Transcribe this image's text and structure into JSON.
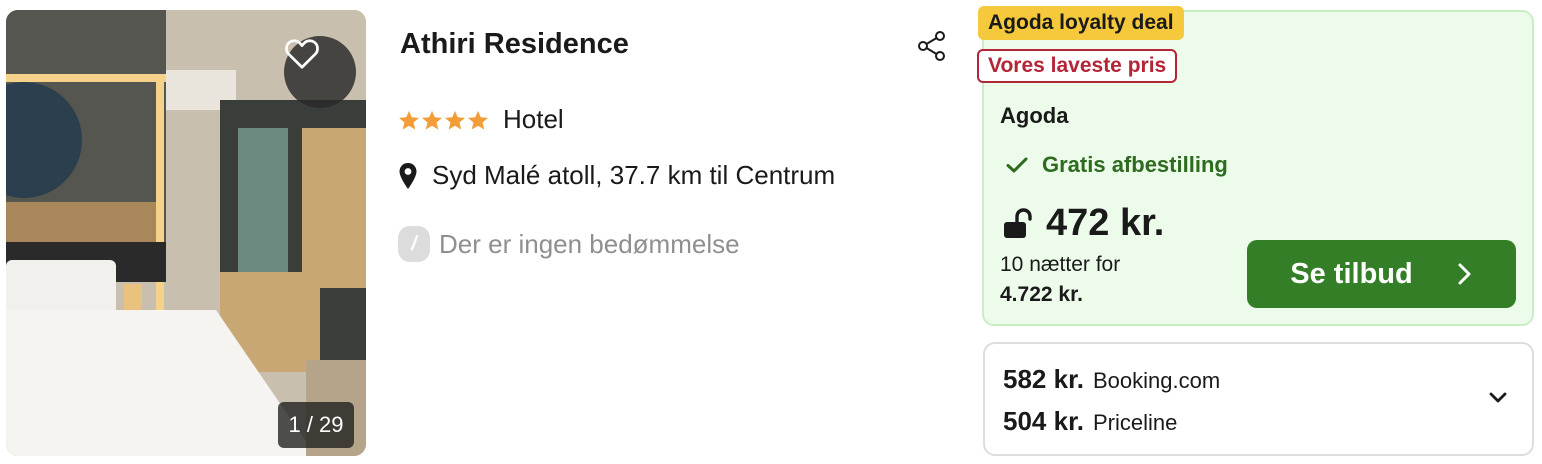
{
  "photo": {
    "counter": "1 / 29",
    "favorite_icon": "heart-outline-icon"
  },
  "hotel": {
    "name": "Athiri Residence",
    "stars": 4,
    "type": "Hotel",
    "location": "Syd Malé atoll, 37.7 km til Centrum",
    "review_badge": "/",
    "review_text": "Der er ingen bedømmelse"
  },
  "deal": {
    "loyalty_tag": "Agoda loyalty deal",
    "lowest_tag": "Vores laveste pris",
    "provider": "Agoda",
    "cancellation": "Gratis afbestilling",
    "price": "472 kr.",
    "nights": "10 nætter for",
    "total": "4.722 kr.",
    "cta_label": "Se tilbud"
  },
  "other_offers": [
    {
      "price": "582 kr.",
      "site": "Booking.com"
    },
    {
      "price": "504 kr.",
      "site": "Priceline"
    }
  ],
  "colors": {
    "star": "#f29d38",
    "cta": "#337e26",
    "deal_bg": "#ecfbea",
    "loyalty": "#f5c93b",
    "lowest": "#b52538"
  }
}
